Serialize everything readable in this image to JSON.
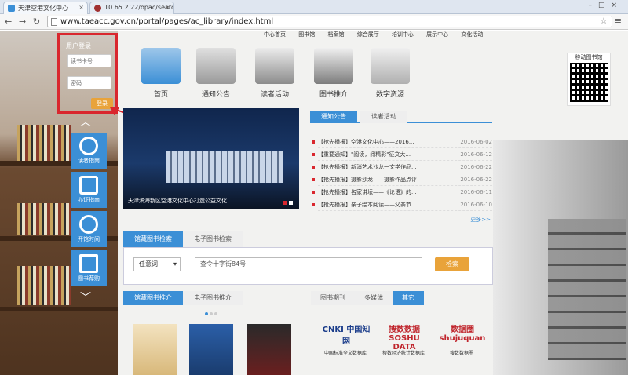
{
  "browser": {
    "tabs": [
      {
        "title": "天津空港文化中心"
      },
      {
        "title": "10.65.2.22/opac/search"
      }
    ],
    "url": "www.taeacc.gov.cn/portal/pages/ac_library/index.html"
  },
  "top_nav": [
    "中心首页",
    "图书馆",
    "档案馆",
    "综合展厅",
    "培训中心",
    "展示中心",
    "文化活动"
  ],
  "quick_icons": [
    {
      "label": "首页",
      "icon": "home-icon"
    },
    {
      "label": "通知公告",
      "icon": "announcement-icon"
    },
    {
      "label": "读者活动",
      "icon": "readers-icon"
    },
    {
      "label": "图书推介",
      "icon": "book-recommend-icon"
    },
    {
      "label": "数字资源",
      "icon": "digital-resource-icon"
    }
  ],
  "qr": {
    "title": "移动图书馆"
  },
  "login": {
    "title": "用户登录",
    "card_placeholder": "读书卡号",
    "password_placeholder": "密码",
    "submit": "登录"
  },
  "side_buttons": [
    {
      "label": "读者指南",
      "icon": "guide-icon"
    },
    {
      "label": "办证指南",
      "icon": "card-icon"
    },
    {
      "label": "开馆时间",
      "icon": "clock-icon"
    },
    {
      "label": "图书荐购",
      "icon": "book-purchase-icon"
    }
  ],
  "banner": {
    "caption": "天津滨海新区空港文化中心打造公益文化"
  },
  "notice": {
    "tabs": [
      "通知公告",
      "读者活动"
    ],
    "items": [
      {
        "text": "【抢先播报】空港文化中心——2016...",
        "date": "2016-06-02"
      },
      {
        "text": "【重要通知】\"阅读，阅精彩\"征文大...",
        "date": "2016-06-12"
      },
      {
        "text": "【抢先播报】新消艺术沙龙一文学作品...",
        "date": "2016-06-22"
      },
      {
        "text": "【抢先播报】摄影沙龙——摄影作品点评",
        "date": "2016-06-22"
      },
      {
        "text": "【抢先播报】名家讲坛——《论语》的...",
        "date": "2016-06-11"
      },
      {
        "text": "【抢先播报】亲子绘本阅读——父亲节...",
        "date": "2016-06-10"
      }
    ],
    "more": "更多>>"
  },
  "search": {
    "tabs": [
      "馆藏图书检索",
      "电子图书检索"
    ],
    "field": "任意词",
    "query": "查令十字街84号",
    "submit": "检索"
  },
  "recommend": {
    "tabs": [
      "馆藏图书推介",
      "电子图书推介"
    ]
  },
  "resources": {
    "tabs": [
      "图书期刊",
      "多媒体",
      "其它"
    ],
    "items": [
      {
        "logo": "CNKI 中国知网",
        "name": "中国标准全文数据库"
      },
      {
        "logo": "搜数数据 SOSHU DATA",
        "name": "搜数经济统计数据库"
      },
      {
        "logo": "数据圈 shujuquan",
        "name": "搜数数据圈"
      }
    ]
  }
}
